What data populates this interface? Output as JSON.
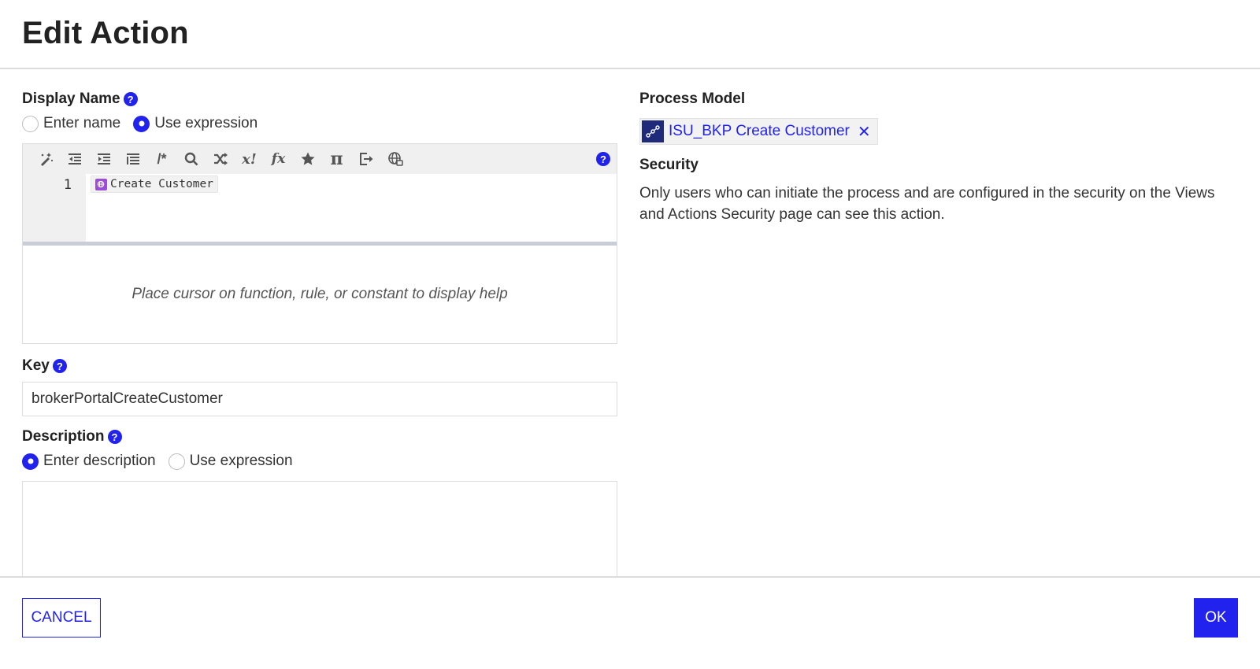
{
  "dialog": {
    "title": "Edit Action"
  },
  "display_name": {
    "label": "Display Name",
    "help_icon": "question-circle-icon",
    "options": [
      {
        "label": "Enter name",
        "checked": false
      },
      {
        "label": "Use expression",
        "checked": true
      }
    ],
    "editor": {
      "toolbar": [
        {
          "name": "format-wand-icon",
          "title": "Format"
        },
        {
          "name": "outdent-icon",
          "title": "Outdent"
        },
        {
          "name": "indent-icon",
          "title": "Indent"
        },
        {
          "name": "list-icon",
          "title": "Lines"
        },
        {
          "name": "comment-icon",
          "title": "Comment",
          "glyph": "/*"
        },
        {
          "name": "search-icon",
          "title": "Find"
        },
        {
          "name": "shuffle-icon",
          "title": "Random"
        },
        {
          "name": "variable-icon",
          "title": "Variable",
          "glyph": "x!"
        },
        {
          "name": "function-icon",
          "title": "Function",
          "glyph": "fx"
        },
        {
          "name": "star-icon",
          "title": "Favorites"
        },
        {
          "name": "pi-icon",
          "title": "Constants",
          "glyph": "π"
        },
        {
          "name": "export-icon",
          "title": "Export"
        },
        {
          "name": "globe-icon",
          "title": "Translations"
        }
      ],
      "help_icon": "question-circle-icon",
      "line_number": "1",
      "token": "Create Customer",
      "help_placeholder": "Place cursor on function, rule, or constant to display help"
    }
  },
  "key": {
    "label": "Key",
    "value": "brokerPortalCreateCustomer"
  },
  "description": {
    "label": "Description",
    "options": [
      {
        "label": "Enter description",
        "checked": true
      },
      {
        "label": "Use expression",
        "checked": false
      }
    ],
    "value": ""
  },
  "process_model": {
    "label": "Process Model",
    "name": "ISU_BKP Create Customer",
    "remove_glyph": "✕"
  },
  "security": {
    "label": "Security",
    "text": "Only users who can initiate the process and are configured in the security on the Views and Actions Security page can see this action."
  },
  "footer": {
    "cancel_label": "CANCEL",
    "ok_label": "OK"
  },
  "colors": {
    "accent": "#2222ee",
    "process_icon_bg": "#1f2b7a",
    "token_icon_bg": "#9b4dd8"
  }
}
